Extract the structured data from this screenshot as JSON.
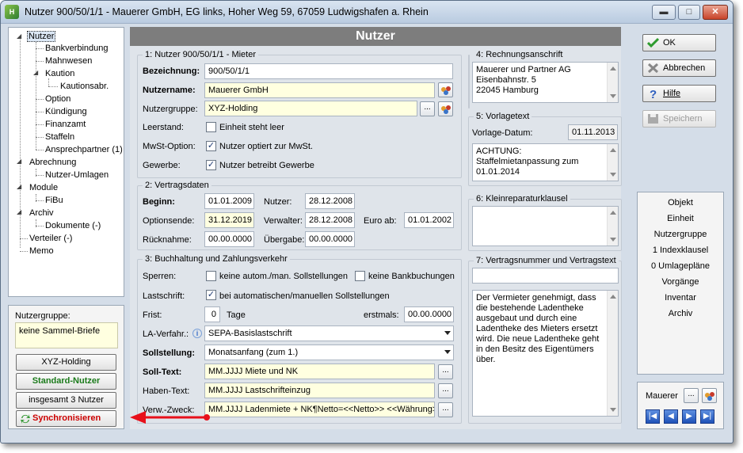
{
  "window": {
    "title": "Nutzer 900/50/1/1 - Mauerer GmbH, EG links, Hoher Weg 59, 67059 Ludwigshafen a. Rhein",
    "min": "▬",
    "max": "□",
    "close": "✕"
  },
  "tree": [
    "Nutzer",
    "Bankverbindung",
    "Mahnwesen",
    "Kaution",
    "Kautionsabr.",
    "Option",
    "Kündigung",
    "Finanzamt",
    "Staffeln",
    "Ansprechpartner (1)",
    "Abrechnung",
    "Nutzer-Umlagen",
    "Module",
    "FiBu",
    "Archiv",
    "Dokumente (-)",
    "Verteiler (-)",
    "Memo"
  ],
  "left": {
    "group_label": "Nutzergruppe:",
    "group_value": "keine Sammel-Briefe",
    "btn_group": "XYZ-Holding",
    "btn_standard": "Standard-Nutzer",
    "btn_total": "insgesamt 3 Nutzer",
    "btn_sync": "Synchronisieren"
  },
  "header": "Nutzer",
  "s1": {
    "title": "1: Nutzer 900/50/1/1 - Mieter",
    "bez_label": "Bezeichnung:",
    "bez": "900/50/1/1",
    "name_label": "Nutzername:",
    "name": "Mauerer GmbH",
    "group_label": "Nutzergruppe:",
    "group": "XYZ-Holding",
    "leer_label": "Leerstand:",
    "leer_cb": "Einheit steht leer",
    "mwst_label": "MwSt-Option:",
    "mwst_cb": "Nutzer optiert zur MwSt.",
    "gew_label": "Gewerbe:",
    "gew_cb": "Nutzer betreibt Gewerbe",
    "ellipsis": "..."
  },
  "s2": {
    "title": "2: Vertragsdaten",
    "beginn_label": "Beginn:",
    "beginn": "01.01.2009",
    "nutzer_label": "Nutzer:",
    "nutzer": "28.12.2008",
    "opt_label": "Optionsende:",
    "opt": "31.12.2019",
    "verw_label": "Verwalter:",
    "verw": "28.12.2008",
    "euro_label": "Euro ab:",
    "euro": "01.01.2002",
    "rueck_label": "Rücknahme:",
    "rueck": "00.00.0000",
    "ueber_label": "Übergabe:",
    "ueber": "00.00.0000"
  },
  "s3": {
    "title": "3: Buchhaltung und Zahlungsverkehr",
    "sperr_label": "Sperren:",
    "sperr_cb1": "keine autom./man. Sollstellungen",
    "sperr_cb2": "keine Bankbuchungen",
    "last_label": "Lastschrift:",
    "last_cb": "bei automatischen/manuellen Sollstellungen",
    "frist_label": "Frist:",
    "frist": "0",
    "tage": "Tage",
    "erst_label": "erstmals:",
    "erst": "00.00.0000",
    "la_label": "LA-Verfahr.:",
    "la": "SEPA-Basislastschrift",
    "soll_label": "Sollstellung:",
    "soll": "Monatsanfang (zum 1.)",
    "sollt_label": "Soll-Text:",
    "sollt": "MM.JJJJ Miete und NK",
    "haben_label": "Haben-Text:",
    "haben": "MM.JJJJ Lastschrifteinzug",
    "verw_label": "Verw.-Zweck:",
    "verwz": "MM.JJJJ Ladenmiete + NK¶Netto=<<Netto>> <<Währung>>'"
  },
  "s4": {
    "title": "4: Rechnungsanschrift",
    "text": "Mauerer und Partner AG\nEisenbahnstr. 5\n22045 Hamburg"
  },
  "s5": {
    "title": "5: Vorlagetext",
    "date_label": "Vorlage-Datum:",
    "date": "01.11.2013",
    "text": "ACHTUNG:\nStaffelmietanpassung zum\n01.01.2014"
  },
  "s6": {
    "title": "6: Kleinreparaturklausel"
  },
  "s7": {
    "title": "7: Vertragsnummer und Vertragstext",
    "text": "Der Vermieter genehmigt, dass die bestehende Ladentheke ausgebaut und durch eine Ladentheke des Mieters ersetzt wird. Die neue Ladentheke geht in den Besitz des Eigentümers über."
  },
  "buttons": {
    "ok": "OK",
    "cancel": "Abbrechen",
    "help": "Hilfe",
    "save": "Speichern"
  },
  "links": [
    "Objekt",
    "Einheit",
    "Nutzergruppe",
    "1 Indexklausel",
    "0 Umlagepläne",
    "Vorgänge",
    "Inventar",
    "Archiv"
  ],
  "bottom": {
    "value": "Mauerer",
    "ellipsis": "..."
  },
  "colors": {
    "header": "#7d7d7d",
    "required_bg": "#ffffe0",
    "arrow": "#e8101a"
  }
}
